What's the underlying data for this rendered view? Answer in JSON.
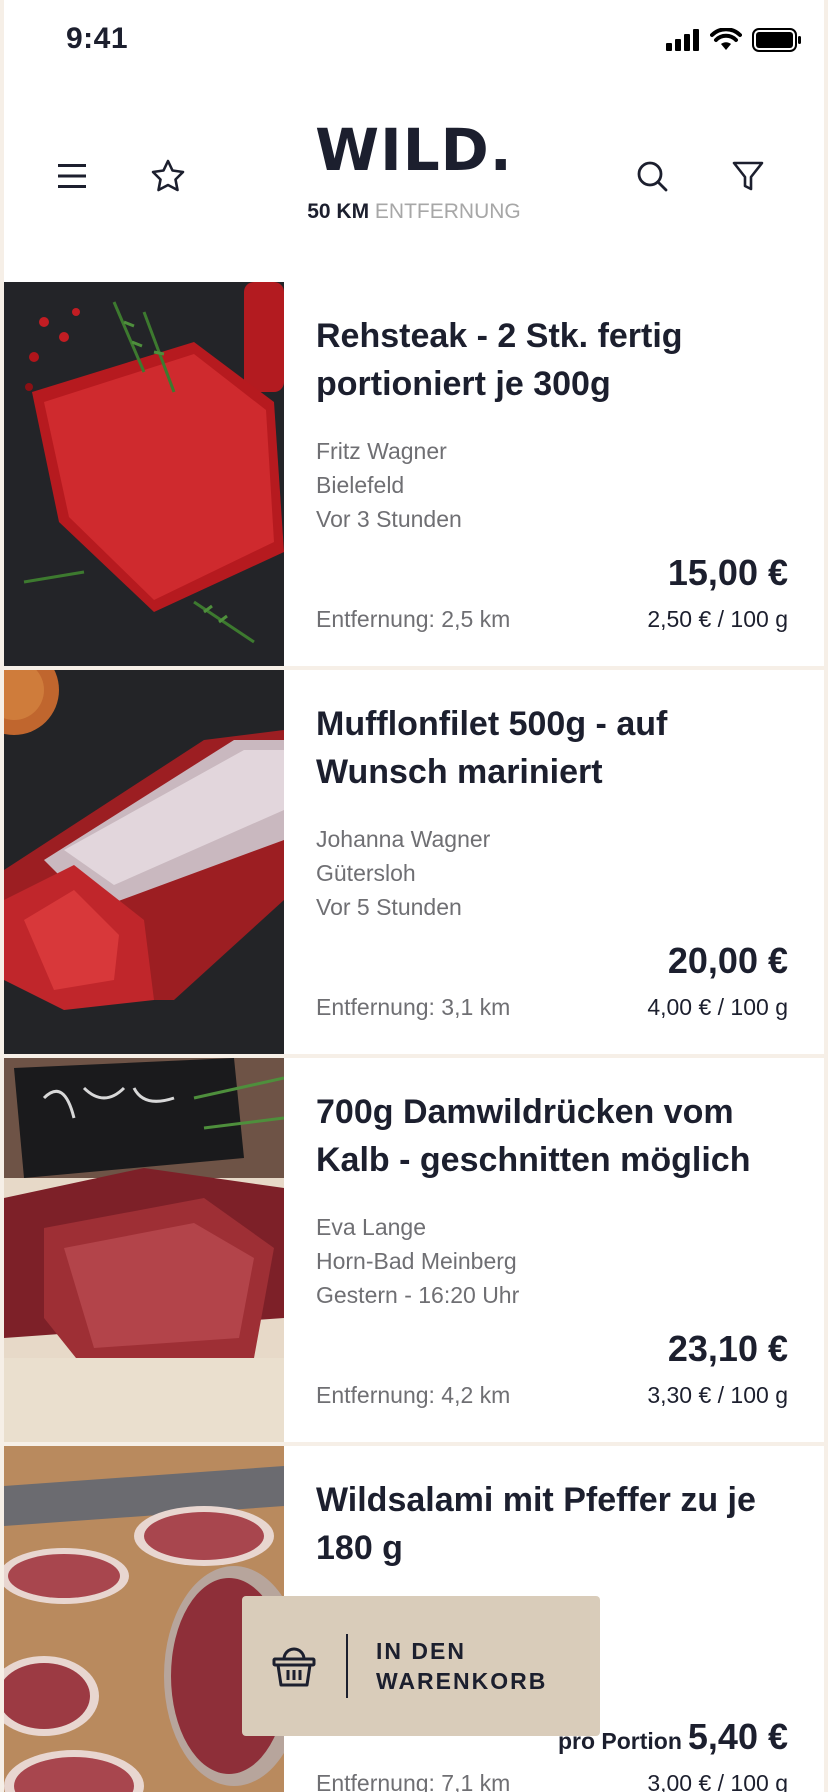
{
  "status_bar": {
    "time": "9:41"
  },
  "header": {
    "logo": "WILD.",
    "distance_value": "50 KM",
    "distance_label": "ENTFERNUNG"
  },
  "items": [
    {
      "title": "Rehsteak - 2 Stk. fertig portioniert je 300g",
      "seller": "Fritz Wagner",
      "city": "Bielefeld",
      "time": "Vor 3 Stunden",
      "price_prefix": "",
      "price": "15,00 €",
      "distance": "Entfernung: 2,5 km",
      "unit_price": "2,50 € / 100 g"
    },
    {
      "title": "Mufflonfilet 500g - auf Wunsch mariniert",
      "seller": "Johanna Wagner",
      "city": "Gütersloh",
      "time": "Vor 5 Stunden",
      "price_prefix": "",
      "price": "20,00 €",
      "distance": "Entfernung: 3,1 km",
      "unit_price": "4,00 € / 100 g"
    },
    {
      "title": "700g Damwildrücken vom Kalb - geschnitten möglich",
      "seller": "Eva Lange",
      "city": "Horn-Bad Meinberg",
      "time": "Gestern - 16:20 Uhr",
      "price_prefix": "",
      "price": "23,10 €",
      "distance": "Entfernung: 4,2 km",
      "unit_price": "3,30 € / 100 g"
    },
    {
      "title": "Wildsalami mit Pfeffer zu je 180 g",
      "seller": "",
      "city": "",
      "time": "",
      "price_prefix": "pro Portion",
      "price": "5,40 €",
      "distance": "Entfernung: 7,1 km",
      "unit_price": "3,00 € / 100 g"
    }
  ],
  "cart_button": {
    "label_line1": "IN DEN",
    "label_line2": "WARENKORB"
  },
  "colors": {
    "text": "#1c1f2e",
    "muted": "#6f6f73",
    "accent": "#d9ccba",
    "separator": "#f6efe7"
  }
}
